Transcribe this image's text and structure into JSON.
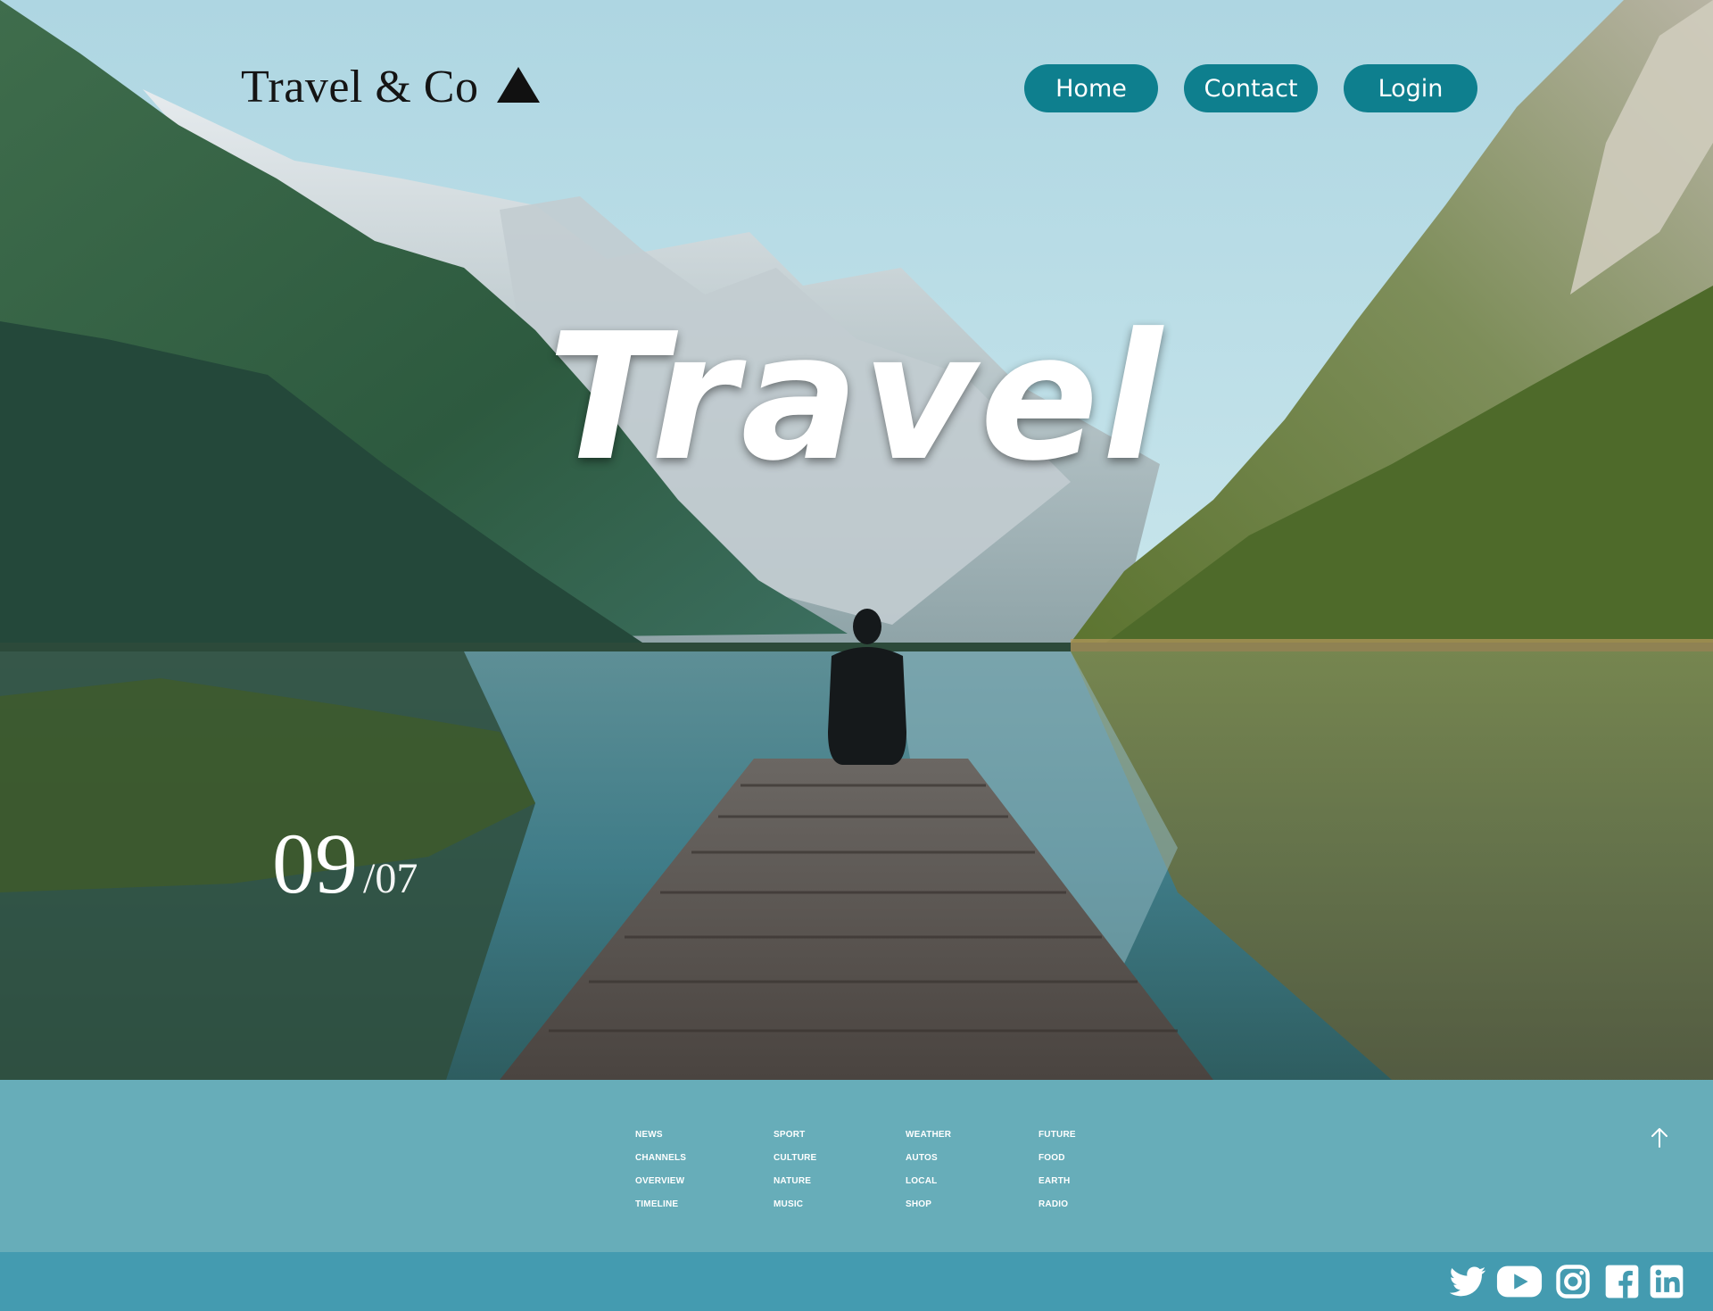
{
  "brand": {
    "name": "Travel & Co",
    "logo_icon": "triangle-icon"
  },
  "nav": {
    "items": [
      {
        "label": "Home"
      },
      {
        "label": "Contact"
      },
      {
        "label": "Login"
      }
    ]
  },
  "hero": {
    "title": "Travel",
    "date_day": "09",
    "date_month": "/07",
    "image": "mountain-lake-pier-photo"
  },
  "footer": {
    "columns": [
      [
        "NEWS",
        "CHANNELS",
        "OVERVIEW",
        "TIMELINE"
      ],
      [
        "SPORT",
        "CULTURE",
        "NATURE",
        "MUSIC"
      ],
      [
        "WEATHER",
        "AUTOS",
        "LOCAL",
        "SHOP"
      ],
      [
        "FUTURE",
        "FOOD",
        "EARTH",
        "RADIO"
      ]
    ],
    "back_to_top_icon": "arrow-up-icon"
  },
  "social": [
    "twitter-icon",
    "youtube-icon",
    "instagram-icon",
    "facebook-icon",
    "linkedin-icon"
  ],
  "colors": {
    "button": "#0e7f8e",
    "footer_links_bg": "#67adb9",
    "social_bar_bg": "#449bb0",
    "sky": "#b5dce6"
  }
}
